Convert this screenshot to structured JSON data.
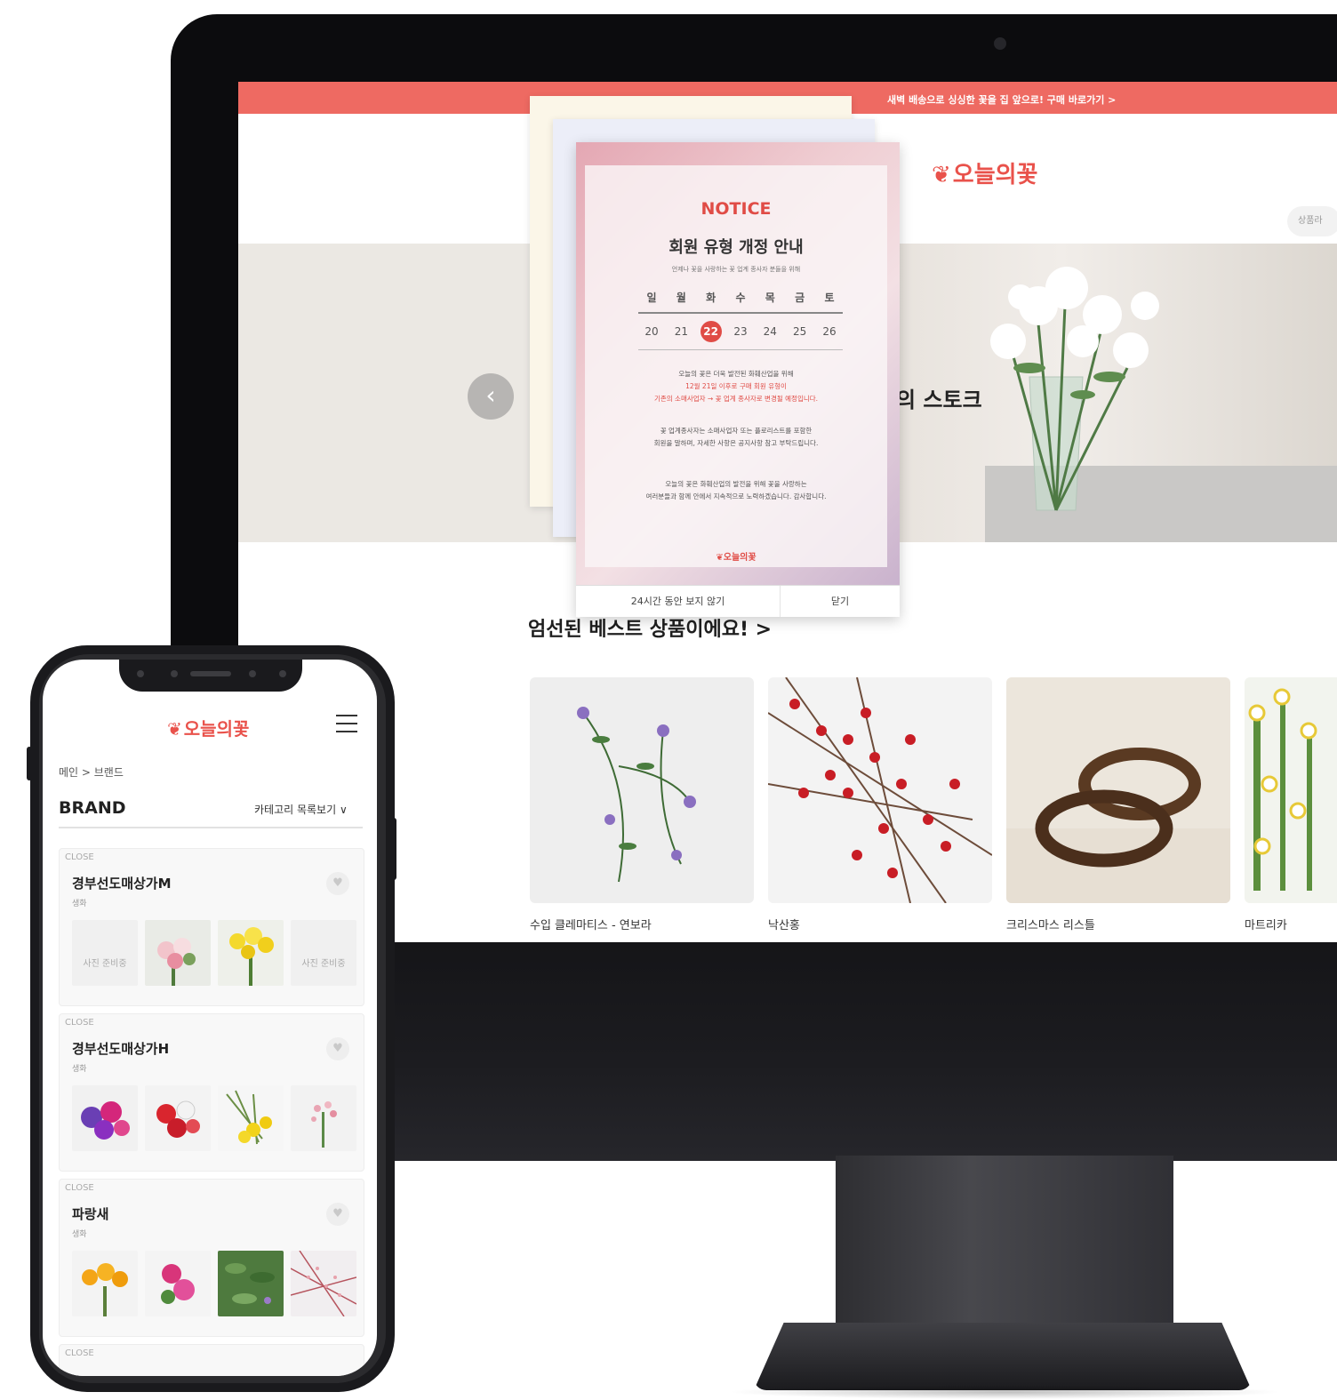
{
  "desktop": {
    "promo_text": "새벽 배송으로 싱싱한 꽃을 집 앞으로! 구매 바로가기 >",
    "logo_text": "오늘의꽃",
    "hero_title": "의 스토크",
    "side_button": "상품라",
    "best_section_title": "엄선된 베스트 상품이에요! >",
    "products": [
      {
        "name": "수입 클레마티스 - 연보라"
      },
      {
        "name": "낙산홍"
      },
      {
        "name": "크리스마스 리스틀"
      },
      {
        "name": "마트리카"
      }
    ],
    "notice": {
      "heading": "NOTICE",
      "title": "회원 유형 개정 안내",
      "subtitle": "언제나 꽃을 사랑하는 꽃 업계 종사자 분들을 위해",
      "weekdays": [
        "일",
        "월",
        "화",
        "수",
        "목",
        "금",
        "토"
      ],
      "dates": [
        "20",
        "21",
        "22",
        "23",
        "24",
        "25",
        "26"
      ],
      "active_date": "22",
      "para1_line1": "오늘의 꽃은 더욱 발전된 화훼산업을 위해",
      "para1_line2": "12월 21일 이후로 구매 회원 유형이",
      "para1_line3": "기존의 소매사업자 → 꽃 업계 종사자로 변경될 예정입니다.",
      "para2_line1": "꽃 업계종사자는 소매사업자 또는 플로리스트를 포함한",
      "para2_line2": "회원을 말하며, 자세한 사항은 공지사항 참고 부탁드립니다.",
      "para3_line1": "오늘의 꽃은 화훼산업의 발전을 위해 꽃을 사랑하는",
      "para3_line2": "여러분들과 함께 안에서 지속적으로 노력하겠습니다. 감사합니다.",
      "logo": "오늘의꽃",
      "hide_24h": "24시간 동안 보지 않기",
      "close": "닫기"
    }
  },
  "mobile": {
    "logo_text": "오늘의꽃",
    "breadcrumb": "메인 > 브랜드",
    "brand_heading": "BRAND",
    "category_toggle": "카테고리 목록보기 ∨",
    "status_label": "CLOSE",
    "placeholder_text": "사진 준비중",
    "stores": [
      {
        "name": "경부선도매상가M",
        "type": "생화"
      },
      {
        "name": "경부선도매상가H",
        "type": "생화"
      },
      {
        "name": "파랑새",
        "type": "생화"
      }
    ]
  },
  "colors": {
    "accent": "#e9524b",
    "promo_bar": "#ee6a62"
  }
}
